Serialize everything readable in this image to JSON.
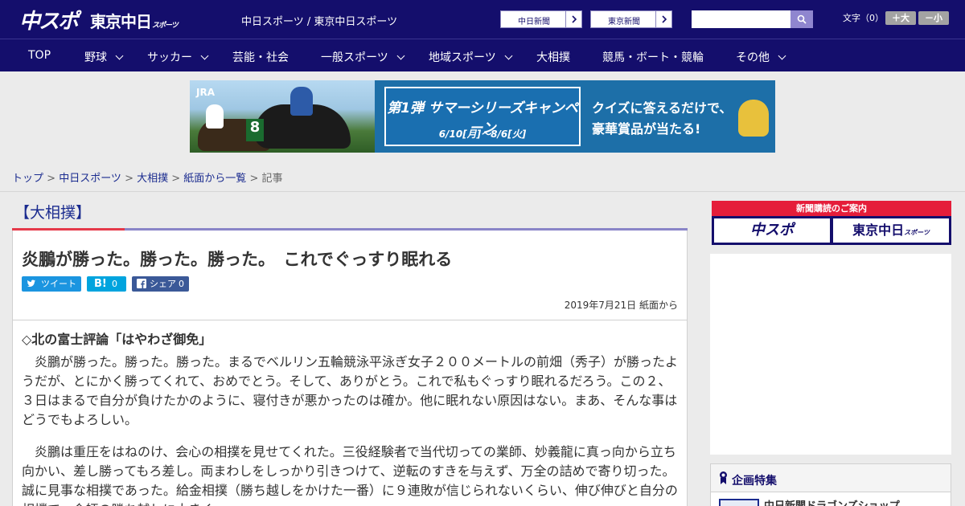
{
  "header": {
    "logo_chunichi": "中スポ",
    "logo_tokyo": "東京中日",
    "logo_tokyo_small": "スポーツ",
    "site_title": "中日スポーツ / 東京中日スポーツ",
    "paper_links": [
      "中日新聞",
      "東京新聞"
    ],
    "search": {
      "placeholder": "",
      "value": ""
    },
    "font_size": {
      "label": "文字（0）",
      "larger": "＋大",
      "smaller": "－小"
    }
  },
  "nav": {
    "items": [
      {
        "label": "TOP",
        "dropdown": false
      },
      {
        "label": "野球",
        "dropdown": true
      },
      {
        "label": "サッカー",
        "dropdown": true
      },
      {
        "label": "芸能・社会",
        "dropdown": false
      },
      {
        "label": "一般スポーツ",
        "dropdown": true
      },
      {
        "label": "地域スポーツ",
        "dropdown": true
      },
      {
        "label": "大相撲",
        "dropdown": false
      },
      {
        "label": "競馬・ボート・競輪",
        "dropdown": false
      },
      {
        "label": "その他",
        "dropdown": true
      }
    ]
  },
  "ad_banner": {
    "brand": "JRA",
    "horse_number": "8",
    "campaign_title": "第1弾 サマーシリーズキャンペーン",
    "campaign_dates": "6/10[月]～8/6[火]",
    "quiz_line1": "クイズに答えるだけで、",
    "quiz_line2": "豪華賞品が当たる!"
  },
  "breadcrumb": {
    "items": [
      "トップ",
      "中日スポーツ",
      "大相撲",
      "紙面から一覧"
    ],
    "current": "記事",
    "separator": " > "
  },
  "article": {
    "category": "【大相撲】",
    "headline": "炎鵬が勝った。勝った。勝った。　これでぐっすり眠れる",
    "share": {
      "tweet_label": "ツイート",
      "hatena_label": "B!",
      "hatena_count": "0",
      "facebook_label": "シェア",
      "facebook_count": "0"
    },
    "date": "2019年7月21日 紙面から",
    "subheading": "◇北の富士評論「はやわざ御免」",
    "paragraphs": [
      "　炎鵬が勝った。勝った。勝った。まるでベルリン五輪競泳平泳ぎ女子２００メートルの前畑（秀子）が勝ったようだが、とにかく勝ってくれて、おめでとう。そして、ありがとう。これで私もぐっすり眠れるだろう。この２、３日はまるで自分が負けたかのように、寝付きが悪かったのは確か。他に眠れない原因はない。まあ、そんな事はどうでもよろしい。",
      "　炎鵬は重圧をはねのけ、会心の相撲を見せてくれた。三役経験者で当代切っての業師、妙義龍に真っ向から立ち向かい、差し勝ってもろ差し。両まわしをしっかり引きつけて、逆転のすきを与えず、万全の詰めで寄り切った。誠に見事な相撲であった。給金相撲（勝ち越しをかけた一番）に９連敗が信じられないくらい、伸び伸びと自分の相撲で、会師の勝ち越しに大きく...."
    ]
  },
  "sidebar": {
    "subscribe_title": "新聞購読のご案内",
    "subscribe_logos": [
      "中スポ",
      "東京中日"
    ],
    "subscribe_logo_small": "スポーツ",
    "special_title": "企画特集",
    "special_item": "中日新聞ドラゴンズショップ"
  },
  "colors": {
    "header_bg": "#140e6c",
    "accent_red": "#e53a4a",
    "twitter": "#1b95e0",
    "hatena": "#00a4de",
    "facebook": "#3b5998"
  }
}
